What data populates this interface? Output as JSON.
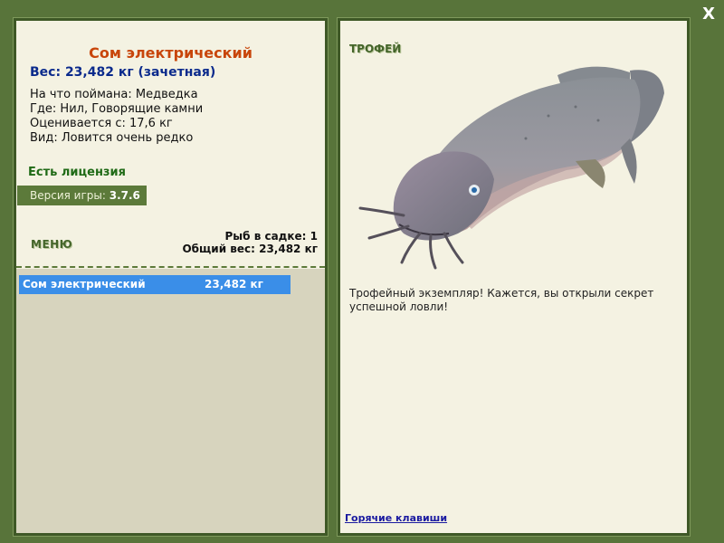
{
  "window": {
    "close_label": "X"
  },
  "fish": {
    "name": "Сом электрический",
    "weight_line": "Вес: 23,482 кг (зачетная)",
    "bait_line": "На что поймана: Медведка",
    "where_line": "Где: Нил, Говорящие камни",
    "value_line": "Оценивается с: 17,6 кг",
    "kind_line": "Вид: Ловится очень редко"
  },
  "license": "Есть лицензия",
  "version": {
    "label": "Версия игры:",
    "value": "3.7.6"
  },
  "menu_label": "МЕНЮ",
  "keepnet": {
    "count_line": "Рыб в садке: 1",
    "total_line": "Общий вес: 23,482 кг",
    "items": [
      {
        "name": "Сом электрический",
        "weight": "23,482 кг"
      }
    ]
  },
  "trophy": {
    "label": "ТРОФЕЙ",
    "message": "Трофейный экземпляр! Кажется, вы открыли секрет успешной ловли!"
  },
  "hotkeys_link": "Горячие клавиши",
  "colors": {
    "background": "#58743a",
    "panel": "#f4f2e2",
    "title": "#c8450a",
    "weight": "#0a2a8c",
    "selected_row": "#3a8ee8"
  }
}
